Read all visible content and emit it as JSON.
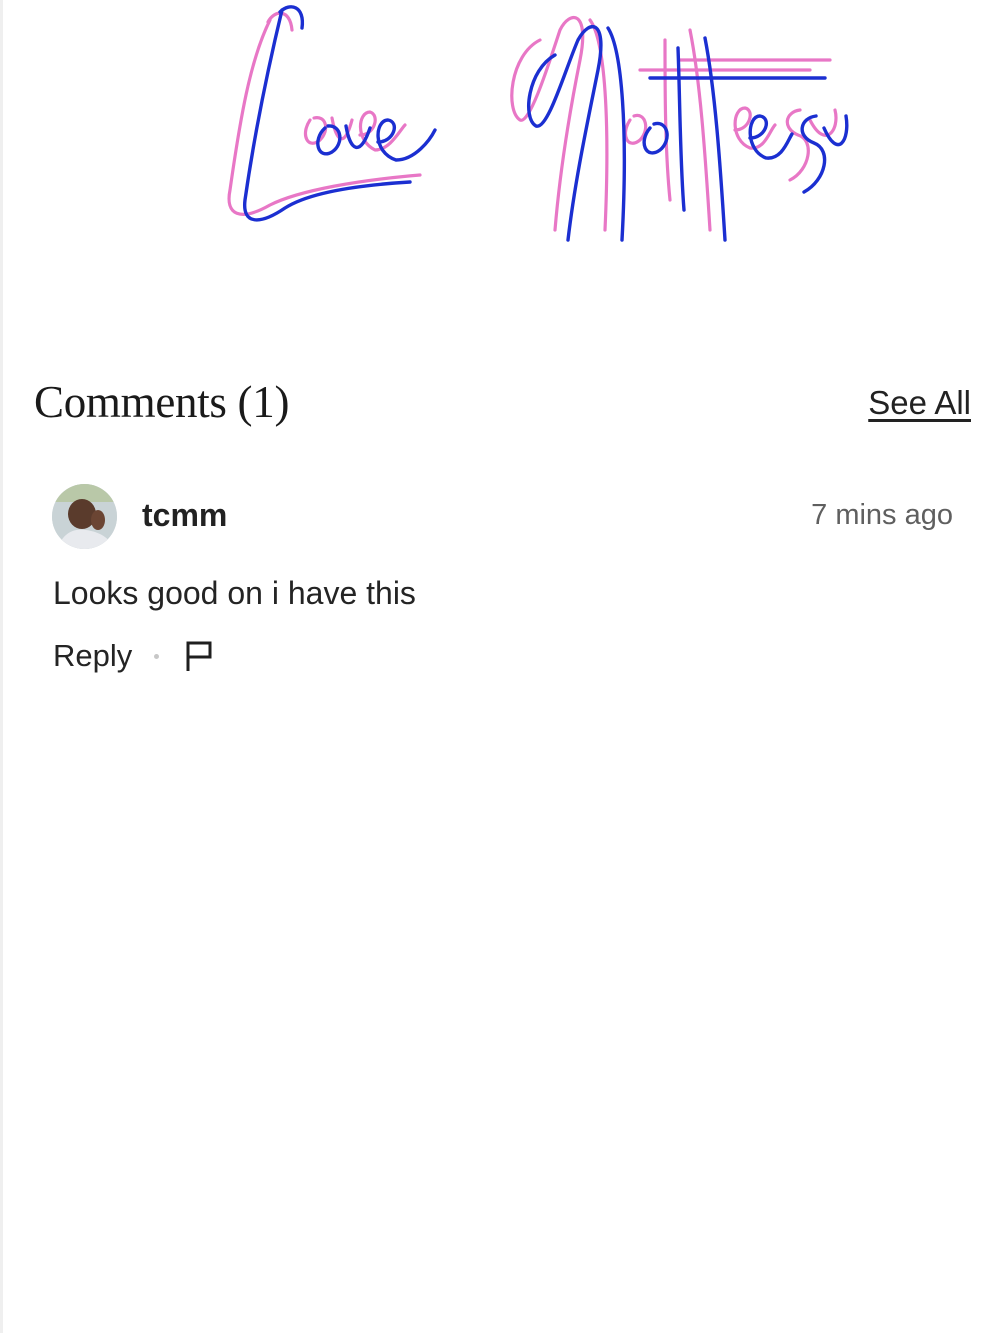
{
  "logo": {
    "text": "Love Notes",
    "colors": {
      "outline": "#e877c6",
      "script": "#1b2fd1"
    }
  },
  "comments": {
    "title": "Comments (1)",
    "see_all_label": "See All"
  },
  "comment": {
    "username": "tcmm",
    "timestamp": "7 mins ago",
    "text": "Looks good on i have this",
    "reply_label": "Reply",
    "flag_icon": "flag-icon"
  }
}
